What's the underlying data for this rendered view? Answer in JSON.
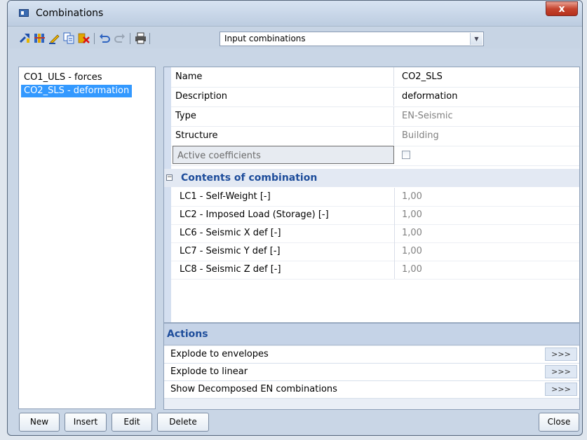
{
  "window": {
    "title": "Combinations",
    "close_glyph": "x"
  },
  "toolbar": {
    "icons": [
      "pin-icon",
      "columns-icon",
      "edit-pencil-icon",
      "copy-icon",
      "delete-x-icon",
      "undo-icon",
      "redo-icon",
      "print-icon"
    ],
    "dropdown_value": "Input combinations"
  },
  "list": {
    "items": [
      {
        "label": "CO1_ULS - forces",
        "selected": false
      },
      {
        "label": "CO2_SLS - deformation",
        "selected": true
      }
    ]
  },
  "properties": {
    "name": {
      "label": "Name",
      "value": "CO2_SLS"
    },
    "description": {
      "label": "Description",
      "value": "deformation"
    },
    "type": {
      "label": "Type",
      "value": "EN-Seismic"
    },
    "structure": {
      "label": "Structure",
      "value": "Building"
    },
    "active_coefficients": {
      "label": "Active coefficients",
      "checked": false
    },
    "contents": {
      "label": "Contents of combination",
      "items": [
        {
          "label": "LC1 - Self-Weight [-]",
          "value": "1,00"
        },
        {
          "label": "LC2 - Imposed Load (Storage) [-]",
          "value": "1,00"
        },
        {
          "label": "LC6 - Seismic X def [-]",
          "value": "1,00"
        },
        {
          "label": "LC7 - Seismic Y def [-]",
          "value": "1,00"
        },
        {
          "label": "LC8 - Seismic Z def [-]",
          "value": "1,00"
        }
      ]
    }
  },
  "actions": {
    "title": "Actions",
    "items": [
      {
        "label": "Explode to envelopes",
        "button": ">>>"
      },
      {
        "label": "Explode to linear",
        "button": ">>>"
      },
      {
        "label": "Show Decomposed EN combinations",
        "button": ">>>"
      }
    ]
  },
  "buttons": {
    "new": "New",
    "insert": "Insert",
    "edit": "Edit",
    "delete": "Delete",
    "close": "Close"
  },
  "colors": {
    "selection": "#3399ff",
    "section_text": "#1e4d9b",
    "close_button": "#c5442f"
  }
}
